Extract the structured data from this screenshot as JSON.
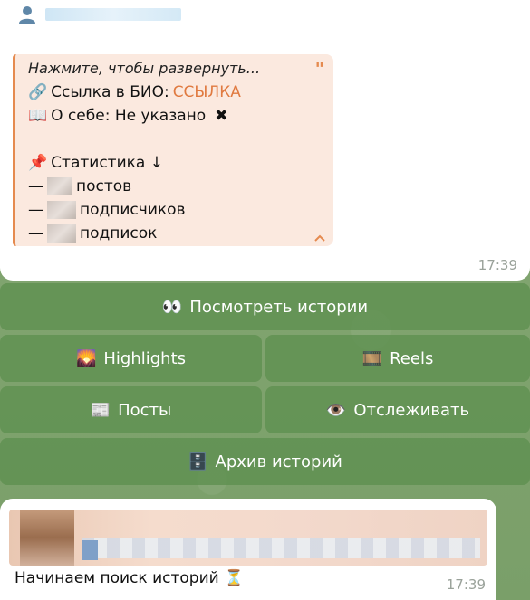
{
  "message1": {
    "quote_header": "Нажмите, чтобы развернуть...",
    "link_icon": "🔗",
    "bio_label": "Ссылка в БИО:",
    "bio_link": "ССЫЛКА",
    "about_icon": "📖",
    "about_text": "О себе: Не указано",
    "about_mark": "✖",
    "stats_icon": "📌",
    "stats_title": "Статистика ↓",
    "dash": "—",
    "posts_label": "постов",
    "followers_label": "подписчиков",
    "following_label": "подписок",
    "time": "17:39"
  },
  "keyboard": {
    "stories": {
      "emoji": "👀",
      "label": "Посмотреть истории"
    },
    "highlights": {
      "emoji": "🌄",
      "label": "Highlights"
    },
    "reels": {
      "emoji": "🎞️",
      "label": "Reels"
    },
    "posts": {
      "emoji": "📰",
      "label": "Посты"
    },
    "track": {
      "emoji": "👁️",
      "label": "Отслеживать"
    },
    "archive": {
      "emoji": "🗄️",
      "label": "Архив историй"
    }
  },
  "message2": {
    "text": "Начинаем поиск историй",
    "emoji": "⏳",
    "time": "17:39"
  },
  "colors": {
    "accent": "#e07a40",
    "button_bg": "#5e8f50",
    "quote_bg": "#fbe9df"
  }
}
